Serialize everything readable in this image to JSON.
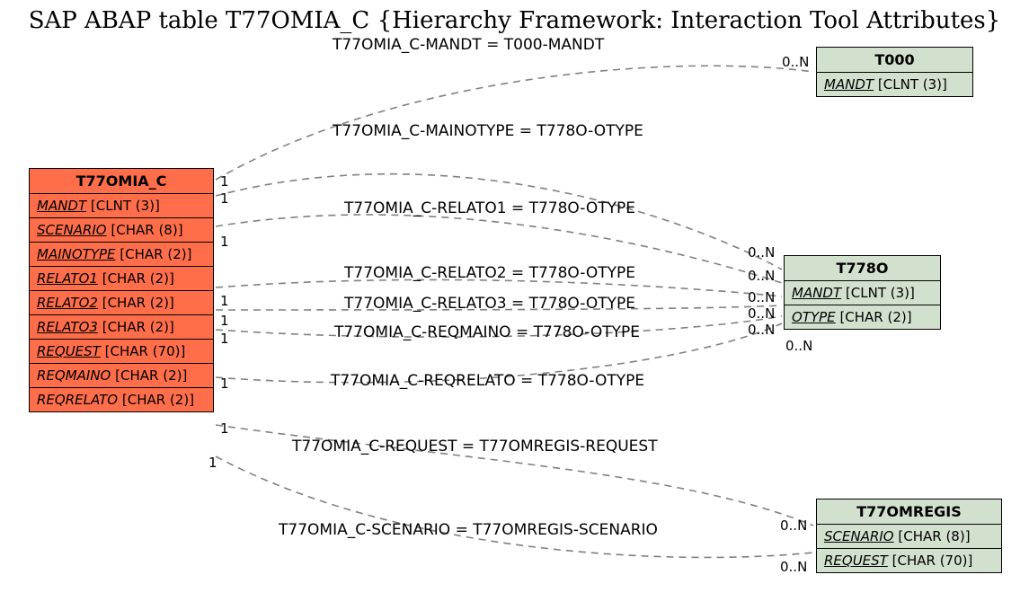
{
  "title": "SAP ABAP table T77OMIA_C {Hierarchy Framework: Interaction Tool Attributes}",
  "tables": {
    "main": {
      "name": "T77OMIA_C",
      "fields": [
        {
          "key": true,
          "name": "MANDT",
          "type": "[CLNT (3)]"
        },
        {
          "key": true,
          "name": "SCENARIO",
          "type": "[CHAR (8)]"
        },
        {
          "key": true,
          "name": "MAINOTYPE",
          "type": "[CHAR (2)]"
        },
        {
          "key": true,
          "name": "RELATO1",
          "type": "[CHAR (2)]"
        },
        {
          "key": true,
          "name": "RELATO2",
          "type": "[CHAR (2)]"
        },
        {
          "key": true,
          "name": "RELATO3",
          "type": "[CHAR (2)]"
        },
        {
          "key": true,
          "name": "REQUEST",
          "type": "[CHAR (70)]"
        },
        {
          "key": false,
          "name": "REQMAINO",
          "type": "[CHAR (2)]"
        },
        {
          "key": false,
          "name": "REQRELATO",
          "type": "[CHAR (2)]"
        }
      ]
    },
    "t000": {
      "name": "T000",
      "fields": [
        {
          "key": true,
          "name": "MANDT",
          "type": "[CLNT (3)]"
        }
      ]
    },
    "t778o": {
      "name": "T778O",
      "fields": [
        {
          "key": true,
          "name": "MANDT",
          "type": "[CLNT (3)]"
        },
        {
          "key": true,
          "name": "OTYPE",
          "type": "[CHAR (2)]"
        }
      ]
    },
    "t77omregis": {
      "name": "T77OMREGIS",
      "fields": [
        {
          "key": true,
          "name": "SCENARIO",
          "type": "[CHAR (8)]"
        },
        {
          "key": true,
          "name": "REQUEST",
          "type": "[CHAR (70)]"
        }
      ]
    }
  },
  "relations": [
    {
      "label": "T77OMIA_C-MANDT = T000-MANDT",
      "left": "1",
      "right": "0..N"
    },
    {
      "label": "T77OMIA_C-MAINOTYPE = T778O-OTYPE",
      "left": "1",
      "right": "0..N"
    },
    {
      "label": "T77OMIA_C-RELATO1 = T778O-OTYPE",
      "left": "1",
      "right": "0..N"
    },
    {
      "label": "T77OMIA_C-RELATO2 = T778O-OTYPE",
      "left": "1",
      "right": "0..N"
    },
    {
      "label": "T77OMIA_C-RELATO3 = T778O-OTYPE",
      "left": "1",
      "right": "0..N"
    },
    {
      "label": "T77OMIA_C-REQMAINO = T778O-OTYPE",
      "left": "1",
      "right": "0..N"
    },
    {
      "label": "T77OMIA_C-REQRELATO = T778O-OTYPE",
      "left": "1",
      "right": "0..N"
    },
    {
      "label": "T77OMIA_C-REQUEST = T77OMREGIS-REQUEST",
      "left": "1",
      "right": "0..N"
    },
    {
      "label": "T77OMIA_C-SCENARIO = T77OMREGIS-SCENARIO",
      "left": "1",
      "right": "0..N"
    }
  ]
}
